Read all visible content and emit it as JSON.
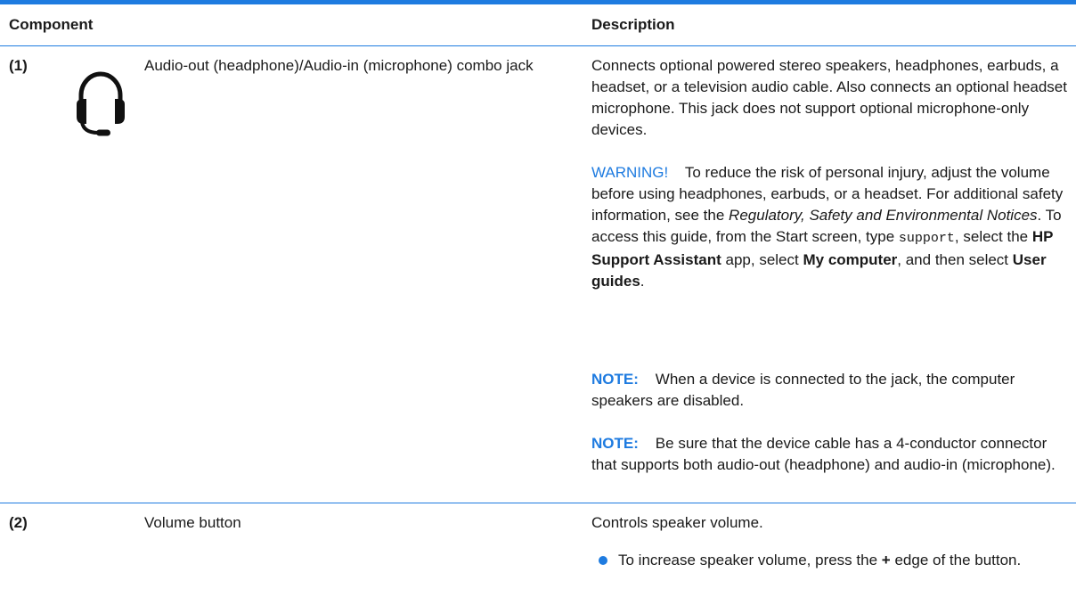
{
  "header": {
    "component": "Component",
    "description": "Description"
  },
  "rows": [
    {
      "number": "(1)",
      "icon": "headset-icon",
      "label": "Audio-out (headphone)/Audio-in (microphone) combo jack",
      "desc_main": "Connects optional powered stereo speakers, headphones, earbuds, a headset, or a television audio cable. Also connects an optional headset microphone. This jack does not support optional microphone-only devices.",
      "warning": {
        "tag": "WARNING!",
        "t1": "To reduce the risk of personal injury, adjust the volume before using headphones, earbuds, or a headset. For additional safety information, see the",
        "doc_title": "Regulatory, Safety and Environmental Notices",
        "t2": ". To access this guide, from the Start screen, type",
        "code": "support",
        "t3": ", select the",
        "app": "HP Support Assistant",
        "t4": "app, select",
        "my_computer": "My computer",
        "t5": ", and then select",
        "user_guides": "User guides",
        "t6": "."
      },
      "note1": {
        "tag": "NOTE:",
        "text": "When a device is connected to the jack, the computer speakers are disabled."
      },
      "note2": {
        "tag": "NOTE:",
        "text": "Be sure that the device cable has a 4-conductor connector that supports both audio-out (headphone) and audio-in (microphone)."
      }
    },
    {
      "number": "(2)",
      "label": "Volume button",
      "desc_main": "Controls speaker volume.",
      "bullet": {
        "t1": "To increase speaker volume, press the",
        "plus": "+",
        "t2": "edge of the button."
      }
    }
  ],
  "colors": {
    "accent": "#1e7be0",
    "text": "#1a1a1a"
  }
}
